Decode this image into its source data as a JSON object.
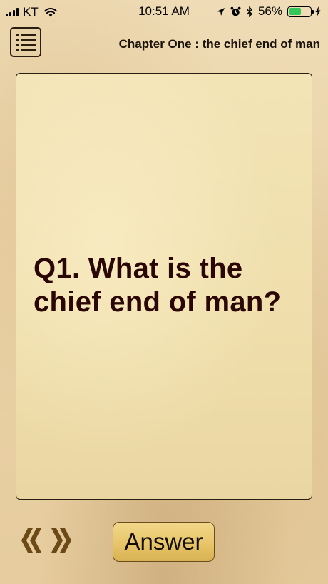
{
  "status_bar": {
    "carrier": "KT",
    "time": "10:51 AM",
    "battery_percent": "56%",
    "battery_level": 0.56,
    "icons": [
      "signal-icon",
      "wifi-icon",
      "location-icon",
      "alarm-icon",
      "bluetooth-icon",
      "battery-icon",
      "charging-icon"
    ]
  },
  "header": {
    "menu_icon": "list-menu-icon",
    "chapter_title": "Chapter One : the chief end of man"
  },
  "card": {
    "question": "Q1. What is the chief end of man?"
  },
  "controls": {
    "previous_icon": "double-chevron-left-icon",
    "next_icon": "double-chevron-right-icon",
    "answer_label": "Answer"
  },
  "colors": {
    "background": "#ead3a8",
    "card": "#f0dfae",
    "question_text": "#2a0605",
    "button_gold": "#e7c56a",
    "arrow_brown": "#6b4a16"
  }
}
